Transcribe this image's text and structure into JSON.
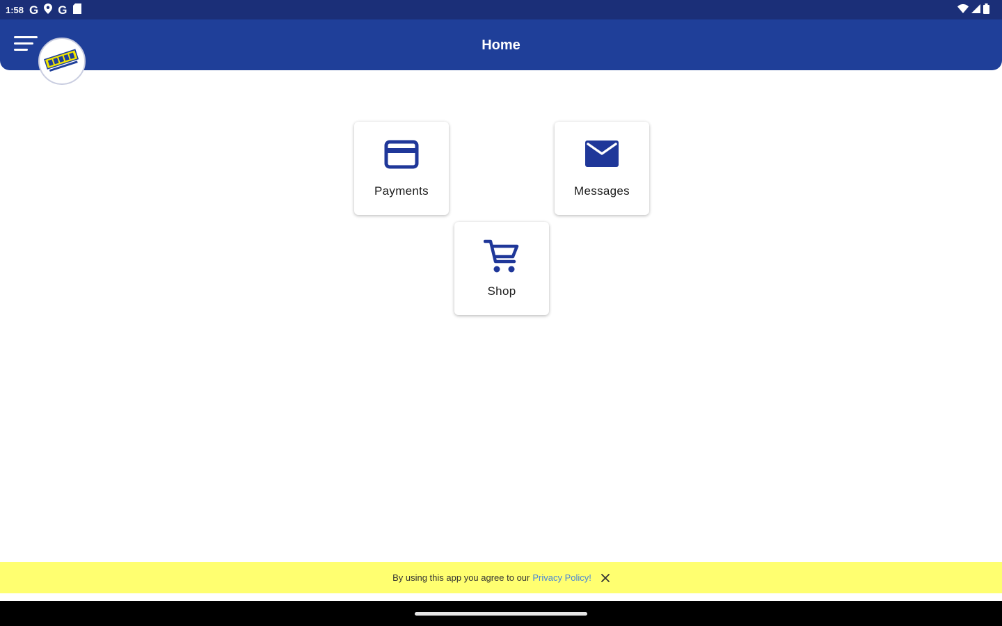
{
  "status_bar": {
    "time": "1:58",
    "notification_icons": [
      "G",
      "G"
    ]
  },
  "app_bar": {
    "title": "Home"
  },
  "tiles": {
    "payments": {
      "label": "Payments",
      "icon": "credit-card-icon"
    },
    "messages": {
      "label": "Messages",
      "icon": "envelope-icon"
    },
    "shop": {
      "label": "Shop",
      "icon": "shopping-cart-icon"
    }
  },
  "banner": {
    "text": "By using this app you agree to our",
    "link": "Privacy Policy!"
  },
  "colors": {
    "status_bar": "#1b2f78",
    "app_bar": "#1f3f99",
    "icon_blue": "#1f3799",
    "banner_bg": "#ffff70",
    "link": "#4a86d8"
  }
}
